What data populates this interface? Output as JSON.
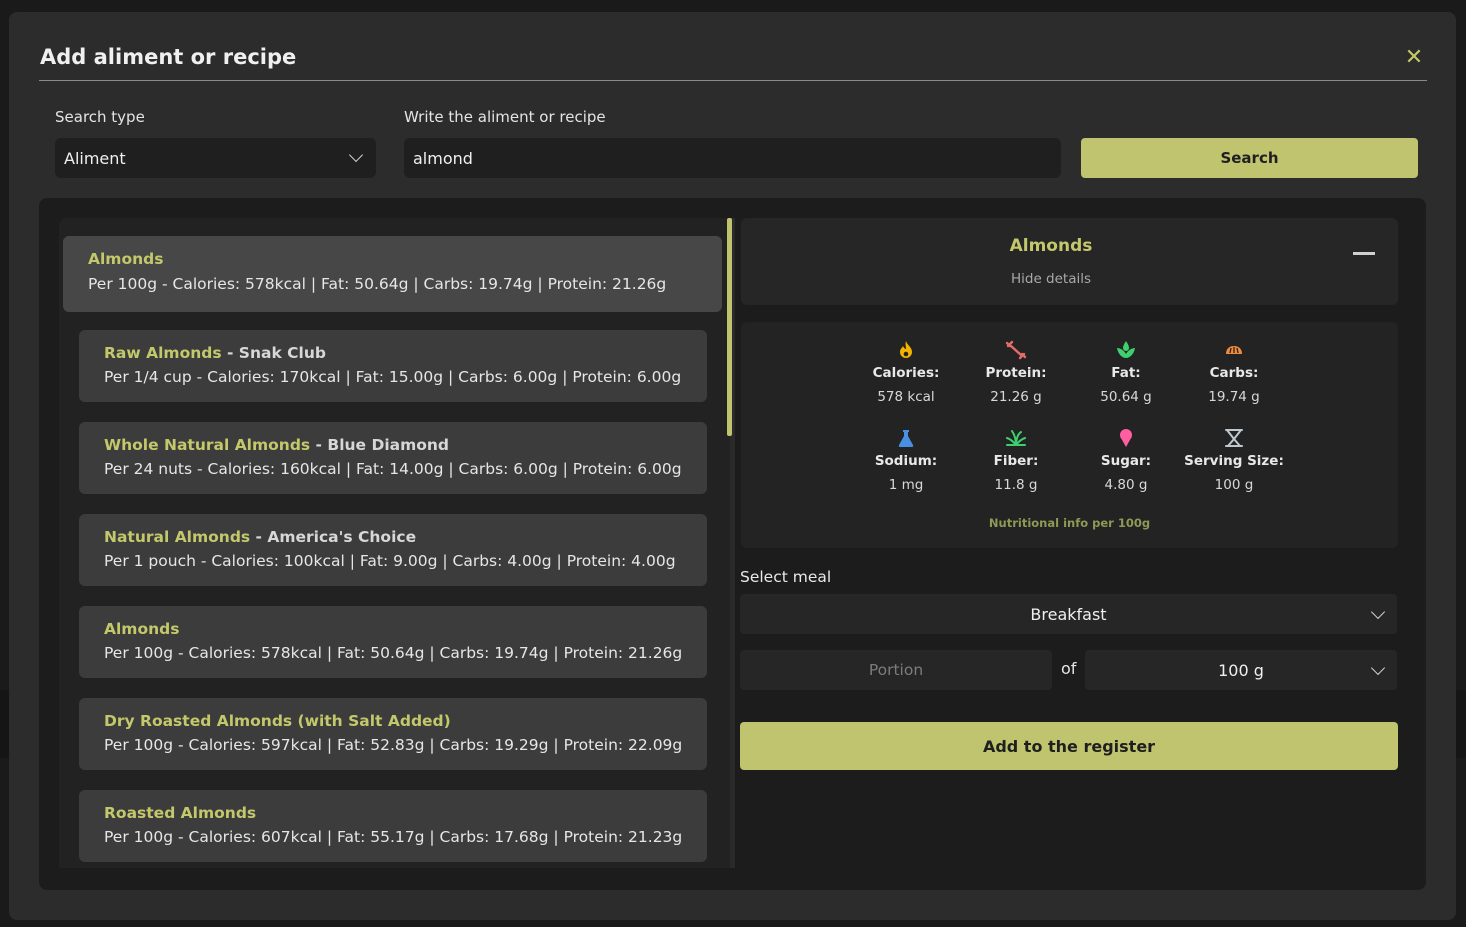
{
  "modal": {
    "title": "Add aliment or recipe",
    "close_icon": "close-icon"
  },
  "search": {
    "type_label": "Search type",
    "type_value": "Aliment",
    "query_label": "Write the aliment or recipe",
    "query_value": "almond",
    "button_label": "Search"
  },
  "results": [
    {
      "name": "Almonds",
      "brand": "",
      "info": "Per 100g - Calories: 578kcal | Fat: 50.64g | Carbs: 19.74g | Protein: 21.26g",
      "selected": true
    },
    {
      "name": "Raw Almonds",
      "brand": " - Snak Club",
      "info": "Per 1/4 cup - Calories: 170kcal | Fat: 15.00g | Carbs: 6.00g | Protein: 6.00g"
    },
    {
      "name": "Whole Natural Almonds",
      "brand": " - Blue Diamond",
      "info": "Per 24 nuts - Calories: 160kcal | Fat: 14.00g | Carbs: 6.00g | Protein: 6.00g"
    },
    {
      "name": "Natural Almonds",
      "brand": " - America's Choice",
      "info": "Per 1 pouch - Calories: 100kcal | Fat: 9.00g | Carbs: 4.00g | Protein: 4.00g"
    },
    {
      "name": "Almonds",
      "brand": "",
      "info": "Per 100g - Calories: 578kcal | Fat: 50.64g | Carbs: 19.74g | Protein: 21.26g"
    },
    {
      "name": "Dry Roasted Almonds (with Salt Added)",
      "brand": "",
      "info": "Per 100g - Calories: 597kcal | Fat: 52.83g | Carbs: 19.29g | Protein: 22.09g"
    },
    {
      "name": "Roasted Almonds",
      "brand": "",
      "info": "Per 100g - Calories: 607kcal | Fat: 55.17g | Carbs: 17.68g | Protein: 21.23g"
    }
  ],
  "detail": {
    "name": "Almonds",
    "hide_label": "Hide details",
    "nutrients": [
      {
        "label": "Calories:",
        "value": "578 kcal",
        "icon": "flame-icon",
        "color": "#f5b300"
      },
      {
        "label": "Protein:",
        "value": "21.26 g",
        "icon": "dumbbell-icon",
        "color": "#e56b6b"
      },
      {
        "label": "Fat:",
        "value": "50.64 g",
        "icon": "leaf-drop-icon",
        "color": "#3ecf6e"
      },
      {
        "label": "Carbs:",
        "value": "19.74 g",
        "icon": "bread-icon",
        "color": "#f08a3c"
      },
      {
        "label": "Sodium:",
        "value": "1 mg",
        "icon": "flask-icon",
        "color": "#4a90e2"
      },
      {
        "label": "Fiber:",
        "value": "11.8 g",
        "icon": "plant-icon",
        "color": "#3ecf6e"
      },
      {
        "label": "Sugar:",
        "value": "4.80 g",
        "icon": "ice-cream-icon",
        "color": "#ff5fa2"
      },
      {
        "label": "Serving Size:",
        "value": "100 g",
        "icon": "scale-icon",
        "color": "#bfc7cf"
      }
    ],
    "note": "Nutritional info per 100g"
  },
  "meal": {
    "label": "Select meal",
    "value": "Breakfast",
    "portion_placeholder": "Portion",
    "of_label": "of",
    "unit_value": "100 g",
    "add_label": "Add to the register"
  },
  "colors": {
    "accent": "#c0c46e",
    "modal_bg": "#2c2c2c",
    "panel_bg": "#1c1c1c"
  }
}
